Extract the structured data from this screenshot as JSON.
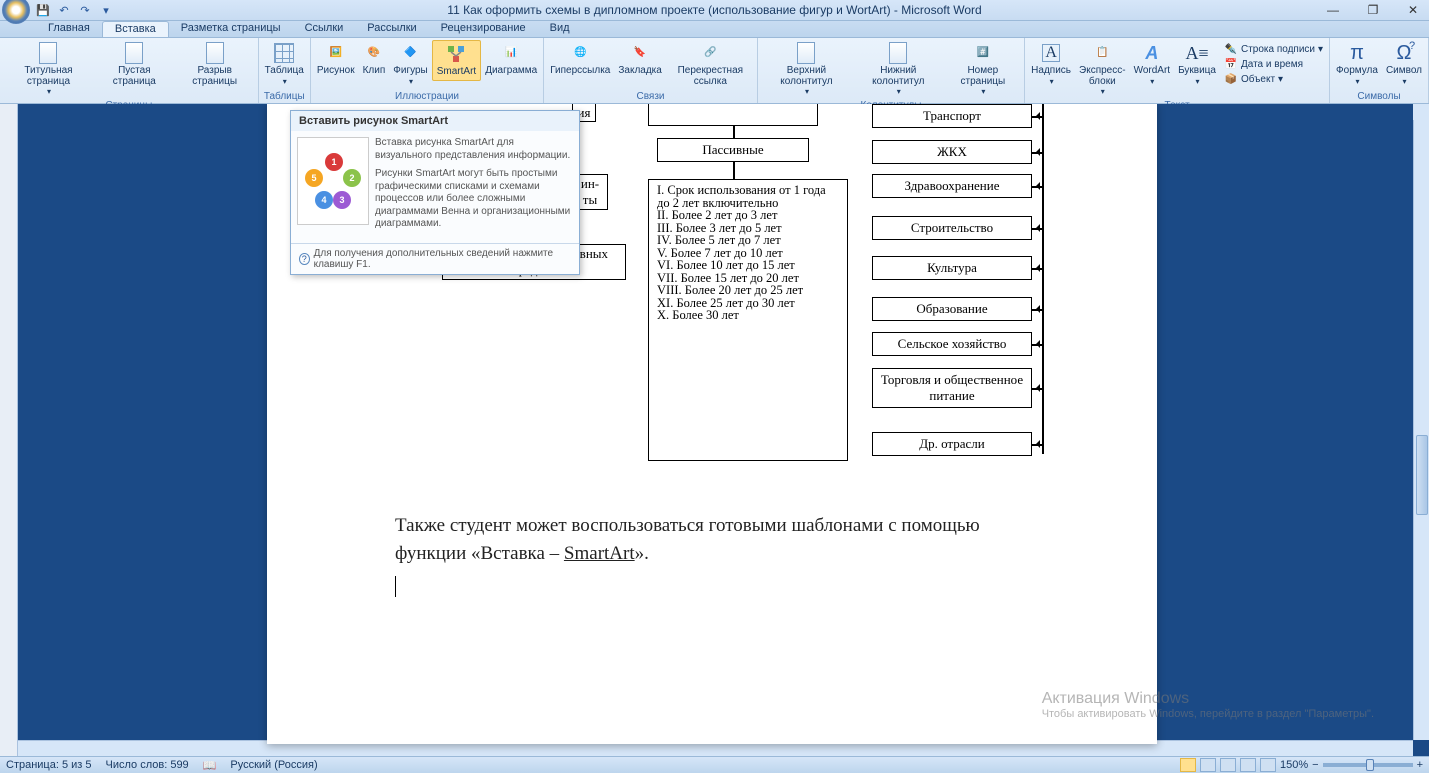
{
  "title": "11 Как оформить схемы в дипломном проекте (использование фигур и WortArt) - Microsoft Word",
  "qat": {
    "save": "save-icon",
    "undo": "↶",
    "redo": "↷"
  },
  "tabs": [
    "Главная",
    "Вставка",
    "Разметка страницы",
    "Ссылки",
    "Рассылки",
    "Рецензирование",
    "Вид"
  ],
  "active_tab": "Вставка",
  "ribbon": {
    "pages": {
      "label": "Страницы",
      "btns": [
        "Титульная страница",
        "Пустая страница",
        "Разрыв страницы"
      ]
    },
    "tables": {
      "label": "Таблицы",
      "btn": "Таблица"
    },
    "illus": {
      "label": "Иллюстрации",
      "btns": [
        "Рисунок",
        "Клип",
        "Фигуры",
        "SmartArt",
        "Диаграмма"
      ]
    },
    "links": {
      "label": "Связи",
      "btns": [
        "Гиперссылка",
        "Закладка",
        "Перекрестная ссылка"
      ]
    },
    "headers": {
      "label": "Колонтитулы",
      "btns": [
        "Верхний колонтитул",
        "Нижний колонтитул",
        "Номер страницы"
      ]
    },
    "text": {
      "label": "Текст",
      "btns": [
        "Надпись",
        "Экспресс-блоки",
        "WordArt",
        "Буквица"
      ],
      "small": [
        "Строка подписи",
        "Дата и время",
        "Объект"
      ]
    },
    "symbols": {
      "label": "Символы",
      "btns": [
        "Формула",
        "Символ"
      ]
    }
  },
  "tooltip": {
    "title": "Вставить рисунок SmartArt",
    "p1": "Вставка рисунка SmartArt для визуального представления информации.",
    "p2": "Рисунки SmartArt могут быть простыми графическими списками и схемами процессов или более сложными диаграммами Венна и организационными диаграммами.",
    "footer": "Для получения дополнительных сведений нажмите клавишу F1."
  },
  "diagram": {
    "left_partial": "ия",
    "left_partial2": "ин-\nты",
    "passive": "Пассивные",
    "other_obj": "Прочие объекты основных средств",
    "center_lines": [
      "I. Срок использования от 1 года до 2 лет включительно",
      "II. Более 2 лет до 3 лет",
      "III. Более 3 лет до 5 лет",
      "IV. Более 5 лет до 7 лет",
      "V. Более 7 лет до 10 лет",
      "VI. Более 10 лет до 15 лет",
      "VII. Более 15 лет до 20 лет",
      "VIII. Более 20 лет до 25 лет",
      "XI. Более 25 лет до 30 лет",
      "X. Более 30 лет"
    ],
    "right": [
      "Транспорт",
      "ЖКХ",
      "Здравоохранение",
      "Строительство",
      "Культура",
      "Образование",
      "Сельское хозяйство",
      "Торговля и общественное питание",
      "Др. отрасли"
    ]
  },
  "paragraph": "Также студент может воспользоваться готовыми шаблонами с помощью функции «Вставка – ",
  "paragraph_link": "SmartArt",
  "paragraph_end": "».",
  "watermark": {
    "l1": "Активация Windows",
    "l2": "Чтобы активировать Windows, перейдите в раздел \"Параметры\"."
  },
  "status": {
    "page": "Страница: 5 из 5",
    "words": "Число слов: 599",
    "lang": "Русский (Россия)",
    "zoom": "150%"
  }
}
